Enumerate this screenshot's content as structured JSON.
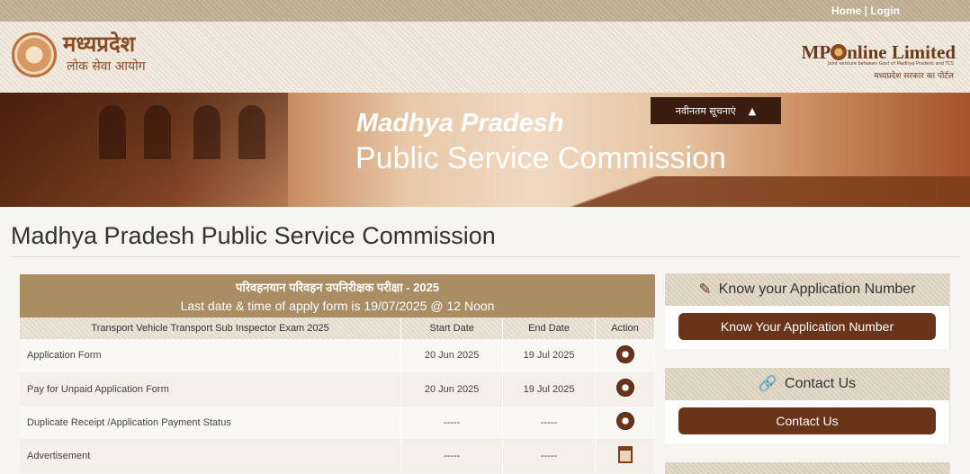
{
  "header": {
    "links": [
      "Home",
      "Login"
    ],
    "logo_main": "मध्यप्रदेश",
    "logo_sub": "लोक सेवा आयोग",
    "partner_name": "MPOnline Limited",
    "partner_prefix": "MP",
    "partner_suffix": "nline Limited",
    "partner_tagline": "Joint venture between Govt of Madhya Pradesh and TCS",
    "partner_hindi": "मध्यप्रदेश सरकार का पोर्टल"
  },
  "banner": {
    "title_line1": "Madhya Pradesh",
    "title_line2": "Public Service Commission",
    "latest_button": "नवीनतम सूचनाएं",
    "latest_icon": "triangle-up-icon"
  },
  "page_title": "Madhya Pradesh Public Service Commission",
  "exam": {
    "heading_hindi": "परिवहनयान परिवहन उपनिरीक्षक परीक्षा - 2025",
    "heading_deadline": "Last date & time of apply form is 19/07/2025 @ 12 Noon",
    "columns": [
      "Transport Vehicle Transport Sub Inspector Exam 2025",
      "Start Date",
      "End Date",
      "Action"
    ],
    "rows": [
      {
        "name": "Application Form",
        "start": "20 Jun 2025",
        "end": "19 Jul 2025",
        "icon": "hand-pointer-icon"
      },
      {
        "name": "Pay for Unpaid Application Form",
        "start": "20 Jun 2025",
        "end": "19 Jul 2025",
        "icon": "hand-pointer-icon"
      },
      {
        "name": "Duplicate Receipt /Application Payment Status",
        "start": "-----",
        "end": "-----",
        "icon": "hand-pointer-icon"
      },
      {
        "name": "Advertisement",
        "start": "-----",
        "end": "-----",
        "icon": "document-icon"
      }
    ]
  },
  "sidebar": {
    "know_app": {
      "heading": "Know your Application Number",
      "icon": "edit-icon",
      "button": "Know Your Application Number"
    },
    "contact": {
      "heading": "Contact Us",
      "icon": "link-icon",
      "button": "Contact Us"
    }
  },
  "colors": {
    "brown": "#6a3418",
    "tan": "#ab8d63"
  }
}
